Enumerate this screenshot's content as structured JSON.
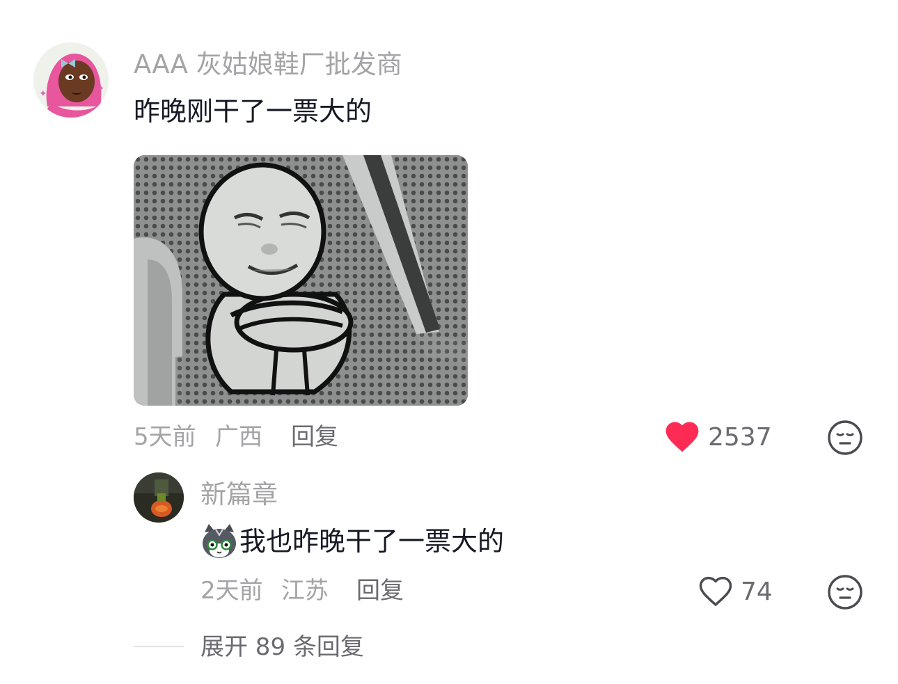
{
  "comment": {
    "username": "AAA 灰姑娘鞋厂批发商",
    "text": "昨晚刚干了一票大的",
    "time": "5天前",
    "location": "广西",
    "reply_label": "回复",
    "like_count": "2537",
    "liked": true,
    "like_icon": "heart-filled-icon",
    "dislike_icon": "meh-face-icon",
    "accent_color": "#fe2c55"
  },
  "reply": {
    "username": "新篇章",
    "emoji": "cat-emoji",
    "text": "我也昨晚干了一票大的",
    "time": "2天前",
    "location": "江苏",
    "reply_label": "回复",
    "like_count": "74",
    "liked": false,
    "like_icon": "heart-outline-icon",
    "dislike_icon": "meh-face-icon"
  },
  "expand": {
    "label": "展开 89 条回复"
  }
}
